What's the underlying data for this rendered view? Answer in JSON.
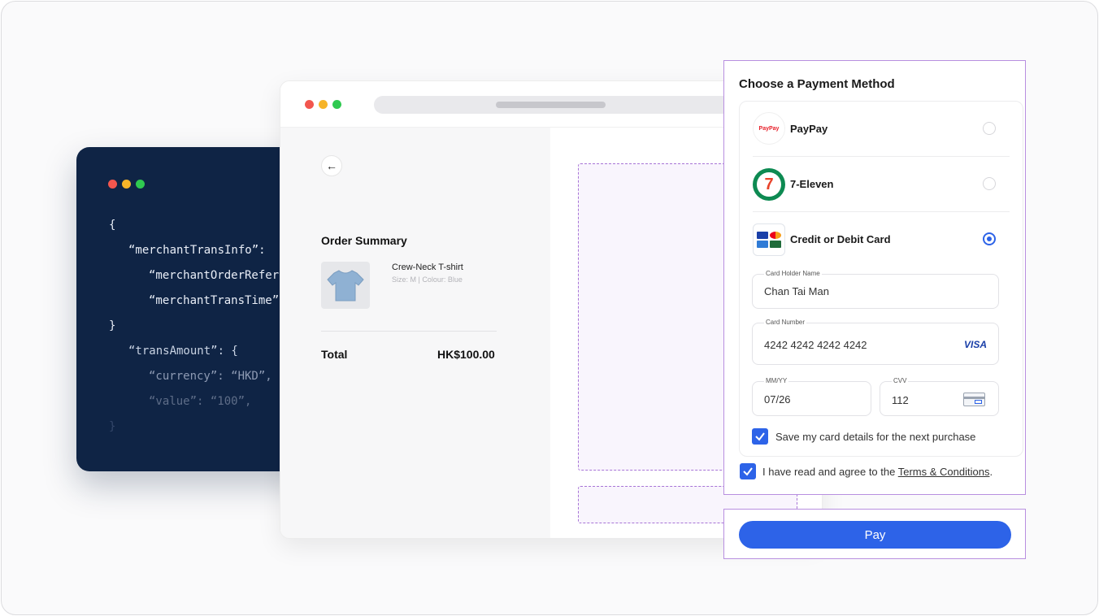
{
  "code": {
    "lines": [
      "{",
      "“merchantTransInfo”:",
      "“merchantOrderRefer",
      "“merchantTransTime”",
      "}",
      "“transAmount”:  {",
      "“currency”:  “HKD”,",
      "“value”:  “100”,",
      "}"
    ]
  },
  "browser": {
    "back_icon": "arrow-left-icon",
    "order_summary_title": "Order Summary",
    "item": {
      "name": "Crew-Neck T-shirt",
      "meta": "Size: M   |   Colour: Blue",
      "image_icon": "tshirt-icon"
    },
    "total_label": "Total",
    "total_value": "HK$100.00"
  },
  "payment": {
    "title": "Choose a Payment Method",
    "methods": [
      {
        "label": "PayPay",
        "icon": "paypay-logo-icon",
        "logo_text": "PayPay",
        "selected": false
      },
      {
        "label": "7-Eleven",
        "icon": "seven-eleven-logo-icon",
        "logo_text": "7",
        "selected": false
      },
      {
        "label": "Credit or Debit Card",
        "icon": "card-brands-icon",
        "selected": true
      }
    ],
    "card_holder": {
      "label": "Card Holder Name",
      "value": "Chan Tai Man"
    },
    "card_number": {
      "label": "Card Number",
      "value": "4242 4242 4242 4242",
      "brand": "VISA"
    },
    "expiry": {
      "label": "MM/YY",
      "value": "07/26"
    },
    "cvv": {
      "label": "CVV",
      "value": "112",
      "icon": "card-cvv-icon"
    },
    "save_card": {
      "label": "Save my card details for the next purchase",
      "checked": true
    },
    "terms": {
      "prefix": "I have read and agree to the ",
      "link": "Terms & Conditions",
      "suffix": ".",
      "checked": true
    },
    "pay_button": "Pay"
  },
  "colors": {
    "accent": "#2d63e8",
    "code_bg": "#0f2445",
    "highlight_border": "#b88fe0"
  }
}
